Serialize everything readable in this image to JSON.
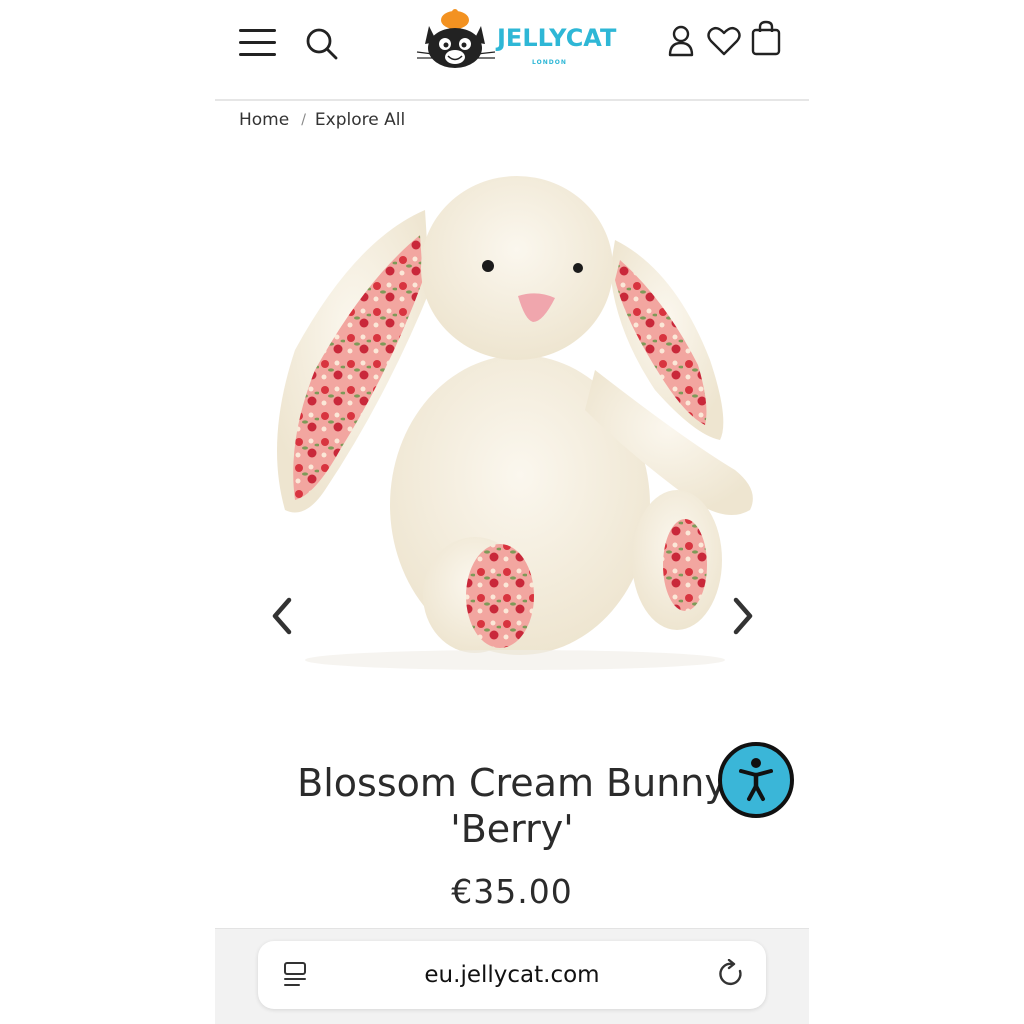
{
  "header": {
    "logo_text": "JELLYCAT",
    "logo_subtext": "LONDON",
    "icons": [
      "menu-icon",
      "search-icon",
      "account-icon",
      "wishlist-icon",
      "bag-icon"
    ]
  },
  "breadcrumb": {
    "items": [
      {
        "label": "Home"
      },
      {
        "label": "Explore All"
      }
    ],
    "separator": "/"
  },
  "product": {
    "title_line1": "Blossom Cream Bunny",
    "title_line2": "'Berry'",
    "price": "€35.00",
    "image_subject": "cream plush bunny with strawberry floral print ears"
  },
  "browser": {
    "url": "eu.jellycat.com"
  },
  "colors": {
    "brand": "#2eb7d6",
    "accessibility_button": "#3ab6d8",
    "text": "#2b2b2b",
    "bunny_fur": "#f6f0e2",
    "print_pink": "#f09a98",
    "strawberry_red": "#d8343f"
  }
}
